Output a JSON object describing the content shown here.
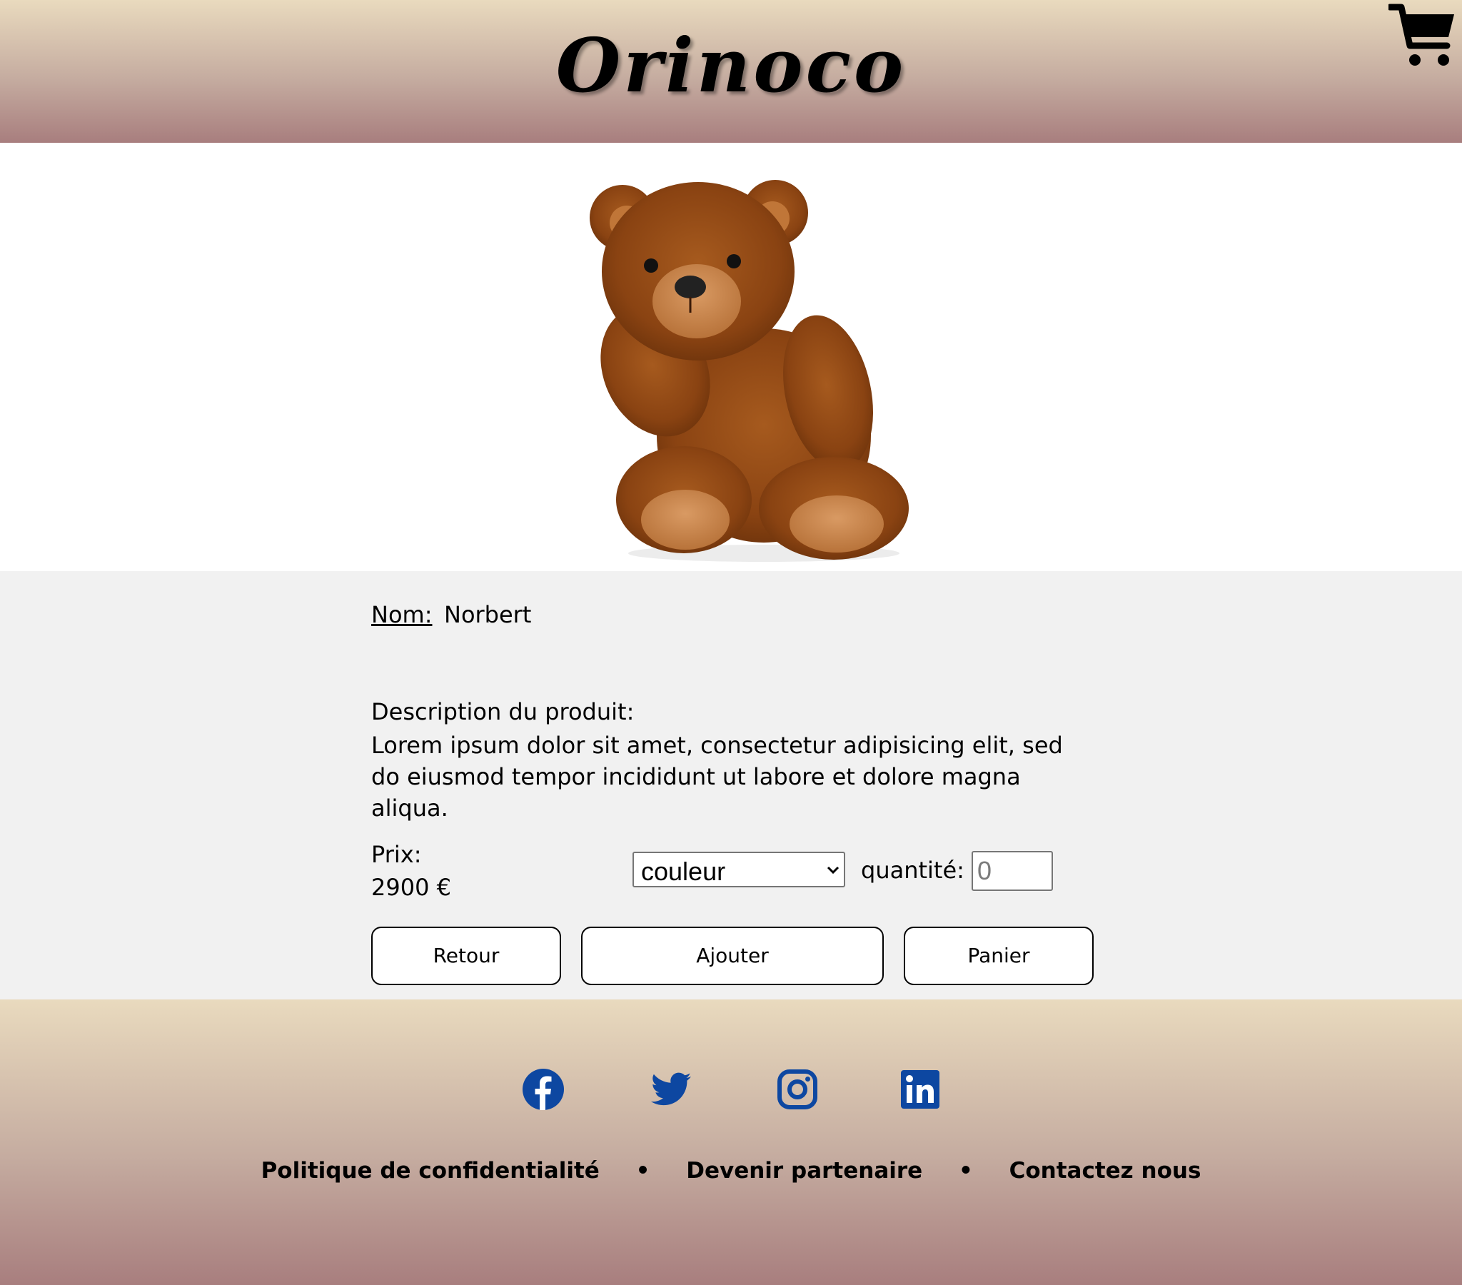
{
  "header": {
    "brand": "Orinoco",
    "cart_icon": "shopping-cart-icon"
  },
  "product": {
    "image_icon": "teddy-bear-photo",
    "name_label": "Nom:",
    "name": "Norbert",
    "description_label": "Description du produit:",
    "description": "Lorem ipsum dolor sit amet, consectetur adipisicing elit, sed do eiusmod tempor incididunt ut labore et dolore magna aliqua.",
    "price_label": "Prix:",
    "price": "2900 €",
    "color_select": {
      "selected": "couleur"
    },
    "quantity_label": "quantité:",
    "quantity_placeholder": "0"
  },
  "buttons": {
    "back": "Retour",
    "add": "Ajouter",
    "cart": "Panier"
  },
  "footer": {
    "social": [
      "facebook-icon",
      "twitter-icon",
      "instagram-icon",
      "linkedin-icon"
    ],
    "social_color": "#0d47a1",
    "links": {
      "privacy": "Politique de confidentialité",
      "partner": "Devenir partenaire",
      "contact": "Contactez nous",
      "separator": "•"
    }
  },
  "colors": {
    "gradient_top": "#e9dabe",
    "gradient_bottom": "#a87e7e",
    "info_bg": "#f1f1f1"
  }
}
